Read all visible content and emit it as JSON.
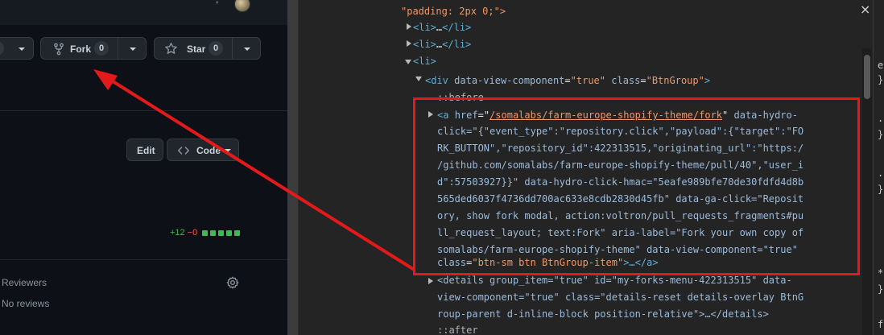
{
  "github": {
    "watch_count": "0",
    "fork_label": "Fork",
    "fork_count": "0",
    "star_label": "Star",
    "star_count": "0",
    "edit_label": "Edit",
    "code_label": "Code",
    "diff_add": "+12",
    "diff_del": "−0",
    "reviewers_heading": "Reviewers",
    "reviewers_value": "No reviews"
  },
  "devtools": {
    "line_padding": "\"padding: 2px 0;\">",
    "li1_open": "<li>",
    "li1_ellipsis": "…",
    "li1_close": "</li>",
    "li2_open": "<li>",
    "li2_ellipsis": "…",
    "li2_close": "</li>",
    "li3_open": "<li>",
    "div_open": "<div",
    "div_attr1_name": "data-view-component",
    "div_attr1_val": "\"true\"",
    "div_attr2_name": "class",
    "div_attr2_val": "\"BtnGroup\"",
    "div_end": ">",
    "before": "::before",
    "a_open": "<a",
    "a_href_name": "href",
    "a_href_val": "/somalabs/farm-europe-shopify-theme/fork",
    "a_line1_tail": "data-hydro-",
    "a_line2": "click=\"{\"event_type\":\"repository.click\",\"payload\":{\"target\":\"FO",
    "a_line3": "RK_BUTTON\",\"repository_id\":422313515,\"originating_url\":\"https:/",
    "a_line4": "/github.com/somalabs/farm-europe-shopify-theme/pull/40\",\"user_i",
    "a_line5": "d\":57503927}}\" data-hydro-click-hmac=\"5eafe989bfe70de30fdfd4d8b",
    "a_line6": "565ded6037f4736dd700ac633e8cdb2830d45fb\" data-ga-click=\"Reposit",
    "a_line7": "ory, show fork modal, action:voltron/pull_requests_fragments#pu",
    "a_line8": "ll_request_layout; text:Fork\" aria-label=\"Fork your own copy of",
    "a_line9": "somalabs/farm-europe-shopify-theme\" data-view-component=\"true\"",
    "a_line10_class_name": "class",
    "a_line10_class_val": "\"btn-sm btn BtnGroup-item\"",
    "a_line10_tail": ">…</a>",
    "details_line1": "<details group_item=\"true\" id=\"my-forks-menu-422313515\" data-",
    "details_line2": "view-component=\"true\" class=\"details-reset details-overlay BtnG",
    "details_line3": "roup-parent d-inline-block position-relative\">…</details>",
    "after": "::after",
    "close_glyph": "×"
  },
  "right_strip": {
    "chars": [
      "e",
      "}",
      ".",
      "}",
      ".",
      "}",
      "*",
      "}",
      "f"
    ]
  },
  "colors": {
    "annotation_red": "#e21a1a",
    "devtools_bg": "#242424",
    "github_bg": "#0d1117"
  }
}
